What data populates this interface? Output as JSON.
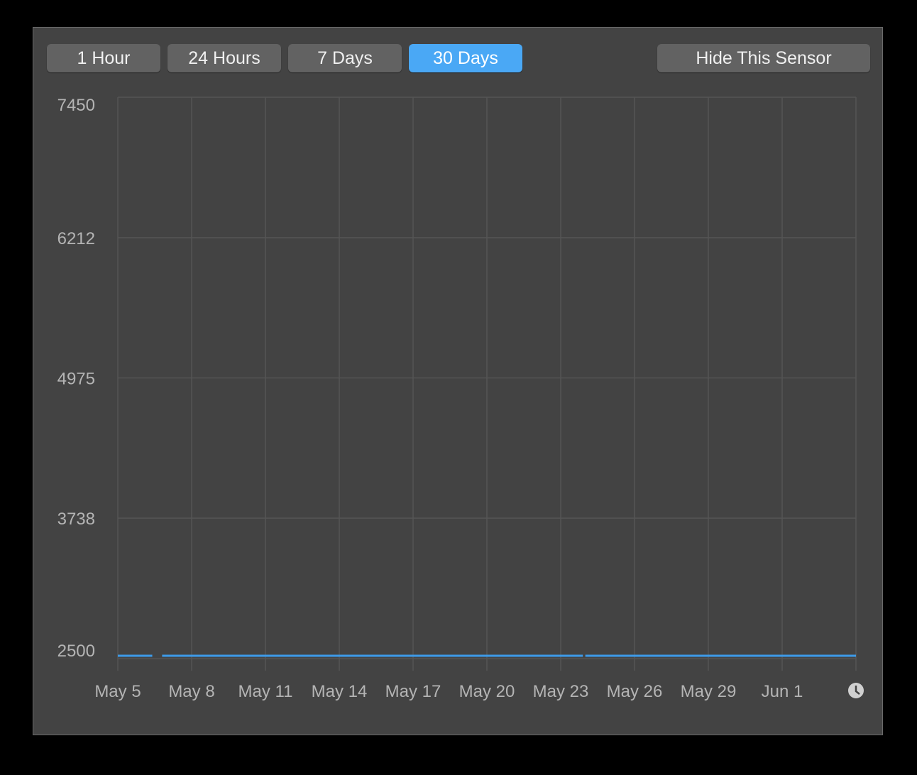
{
  "toolbar": {
    "ranges": [
      "1 Hour",
      "24 Hours",
      "7 Days",
      "30 Days"
    ],
    "selected": "30 Days",
    "hide_label": "Hide This Sensor"
  },
  "colors": {
    "accent": "#4aa8f5",
    "line": "#3d9be9",
    "background": "#434343",
    "grid": "#555555"
  },
  "chart_data": {
    "type": "line",
    "title": "",
    "xlabel": "",
    "ylabel": "",
    "ylim": [
      2500,
      7450
    ],
    "yticks": [
      "7450",
      "6212",
      "4975",
      "3738",
      "2500"
    ],
    "xlim": [
      "May 5",
      "Jun 4"
    ],
    "xticks": [
      "May 5",
      "May 8",
      "May 11",
      "May 14",
      "May 17",
      "May 20",
      "May 23",
      "May 26",
      "May 29",
      "Jun 1"
    ],
    "grid": true,
    "series": [
      {
        "segments": [
          {
            "start": "May 5",
            "end": "May 6.4",
            "value": 2525
          },
          {
            "start": "May 6.8",
            "end": "May 23.9",
            "value": 2525
          },
          {
            "start": "May 24.0",
            "end": "Jun 4",
            "value": 2525
          }
        ]
      }
    ],
    "icon": "clock-icon"
  }
}
